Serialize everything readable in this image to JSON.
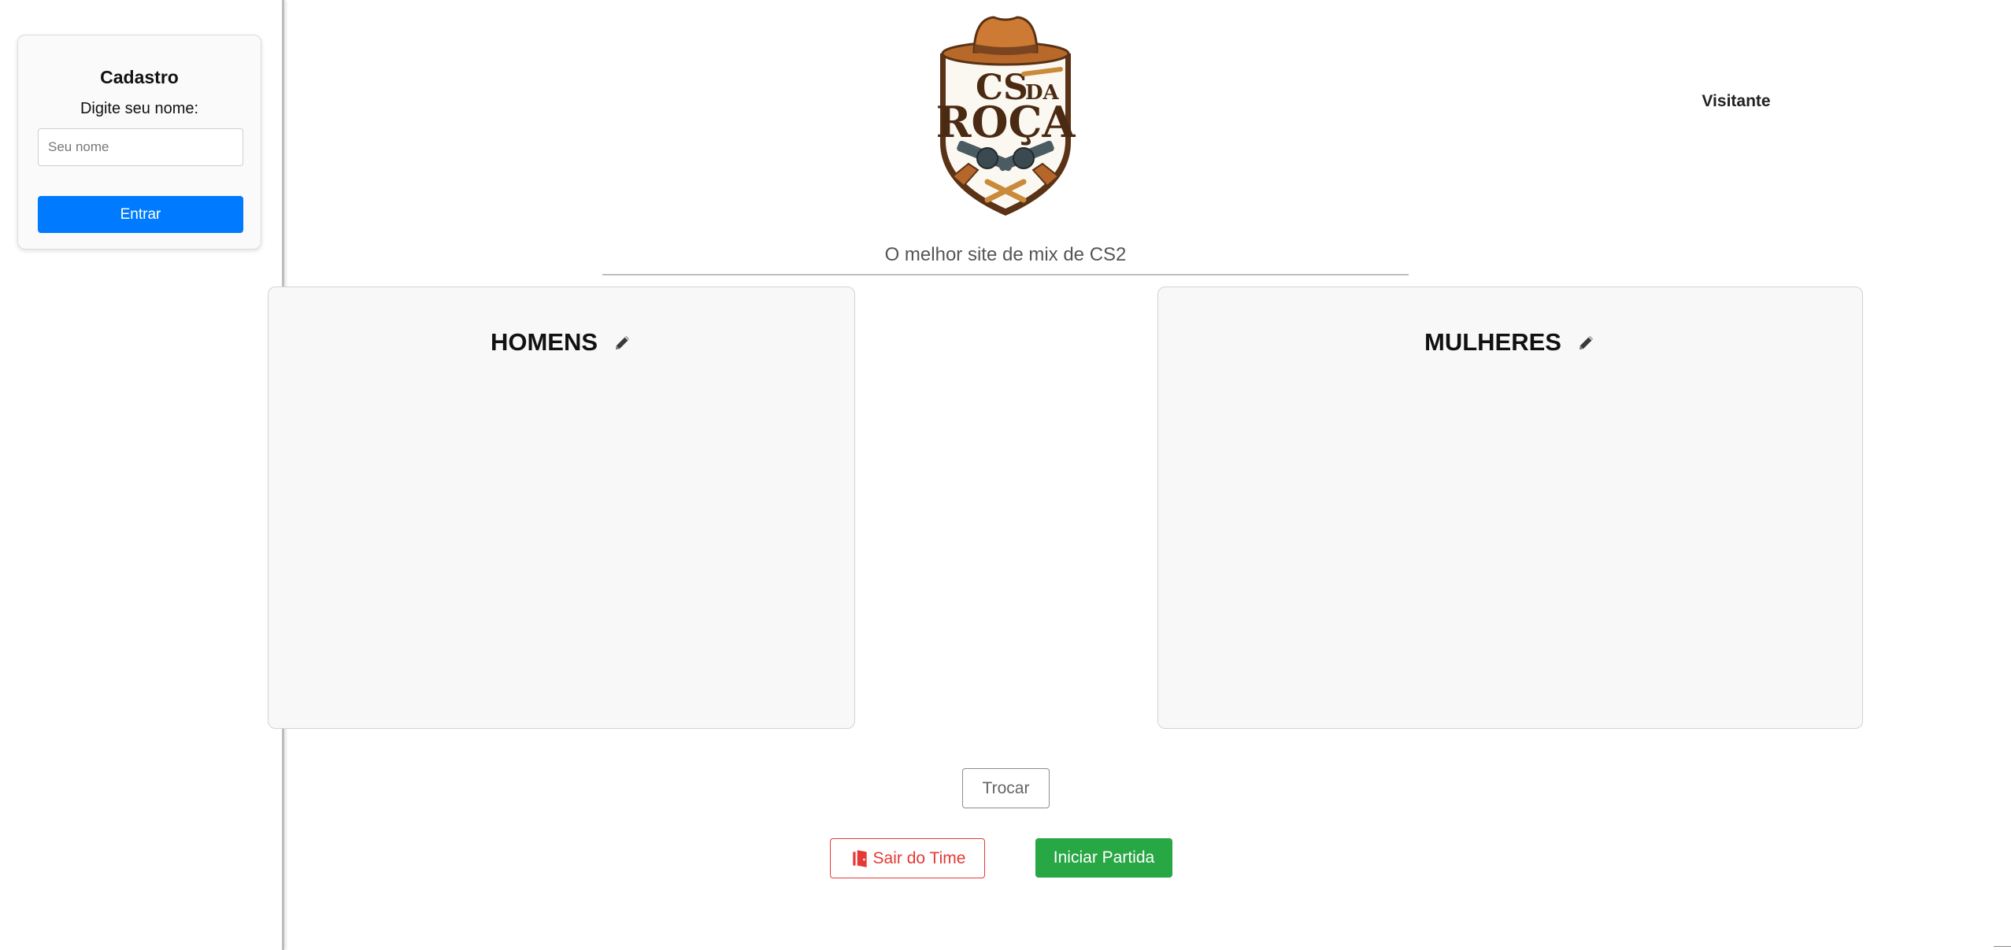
{
  "login": {
    "title": "Cadastro",
    "label": "Digite seu nome:",
    "input_placeholder": "Seu nome",
    "input_value": "",
    "submit_label": "Entrar"
  },
  "header": {
    "logo_icon": "cs-da-roca-logo",
    "logo_text_line1": "CS DA",
    "logo_text_line2": "ROÇA",
    "user_name": "Visitante",
    "tagline": "O melhor site de mix de CS2"
  },
  "teams": {
    "men": {
      "title": "HOMENS",
      "edit_icon": "pencil-icon",
      "players": []
    },
    "women": {
      "title": "MULHERES",
      "edit_icon": "pencil-icon",
      "players": []
    }
  },
  "actions": {
    "swap_label": "Trocar",
    "leave_label": "Sair do Time",
    "leave_icon": "door-exit-icon",
    "start_label": "Iniciar Partida"
  },
  "colors": {
    "primary": "#007bff",
    "success": "#28a745",
    "danger": "#e53935"
  }
}
